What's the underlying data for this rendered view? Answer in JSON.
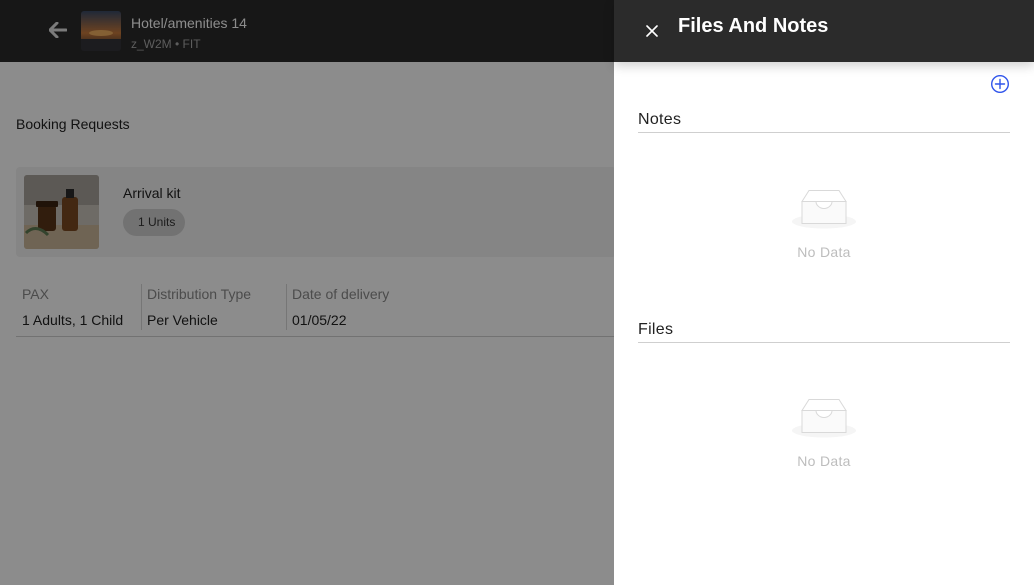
{
  "header": {
    "title": "Hotel/amenities 14",
    "subtitle": "z_W2M • FIT"
  },
  "booking": {
    "section_title": "Booking Requests",
    "item": {
      "name": "Arrival kit",
      "units": "1 Units"
    },
    "info": [
      {
        "label": "PAX",
        "value": "1 Adults, 1 Child"
      },
      {
        "label": "Distribution Type",
        "value": "Per Vehicle"
      },
      {
        "label": "Date of delivery",
        "value": "01/05/22"
      }
    ]
  },
  "drawer": {
    "title": "Files And Notes",
    "notes": {
      "heading": "Notes",
      "empty_text": "No Data"
    },
    "files": {
      "heading": "Files",
      "empty_text": "No Data"
    }
  },
  "colors": {
    "topbar": "#2b2b2b",
    "accent": "#2f54eb",
    "overlay": "rgba(0,0,0,0.45)"
  },
  "icons": [
    "arrow-left-icon",
    "close-icon",
    "plus-circle-icon",
    "inbox-empty-icon"
  ]
}
